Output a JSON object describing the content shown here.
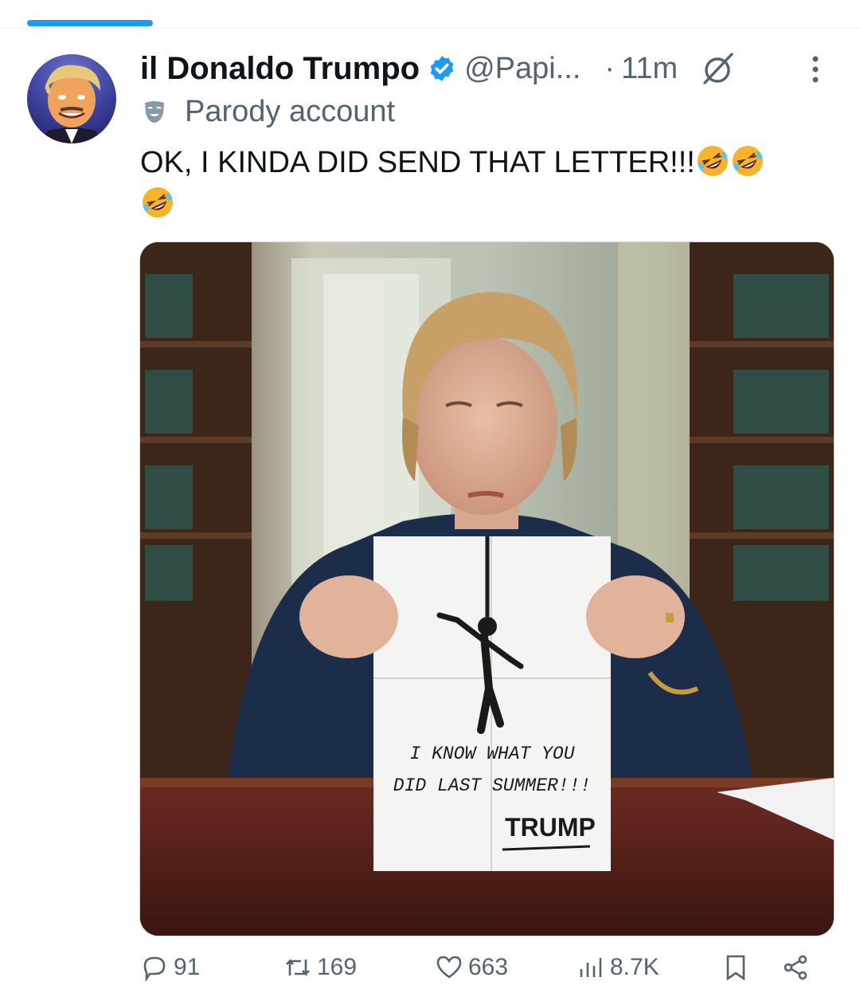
{
  "tweet": {
    "display_name": "il Donaldo Trumpo",
    "handle": "@Papi...",
    "separator": "·",
    "timestamp": "11m",
    "account_label": "Parody account",
    "text": "OK, I KINDA DID SEND THAT LETTER!!!",
    "emojis": [
      "rolling-on-floor-laughing",
      "rolling-on-floor-laughing",
      "rolling-on-floor-laughing"
    ]
  },
  "media": {
    "paper_text": {
      "line1": "I KNOW WHAT YOU",
      "line2": "DID LAST SUMMER!!!",
      "signature": "TRUMP"
    }
  },
  "actions": {
    "replies": "91",
    "reposts": "169",
    "likes": "663",
    "views": "8.7K"
  },
  "colors": {
    "accent": "#1d9bf0",
    "secondary_text": "#536471",
    "primary_text": "#0f1419"
  },
  "icons": [
    "verified-badge-icon",
    "grok-icon",
    "more-icon",
    "parody-mask-icon",
    "reply-icon",
    "repost-icon",
    "like-icon",
    "views-icon",
    "bookmark-icon",
    "share-icon"
  ]
}
